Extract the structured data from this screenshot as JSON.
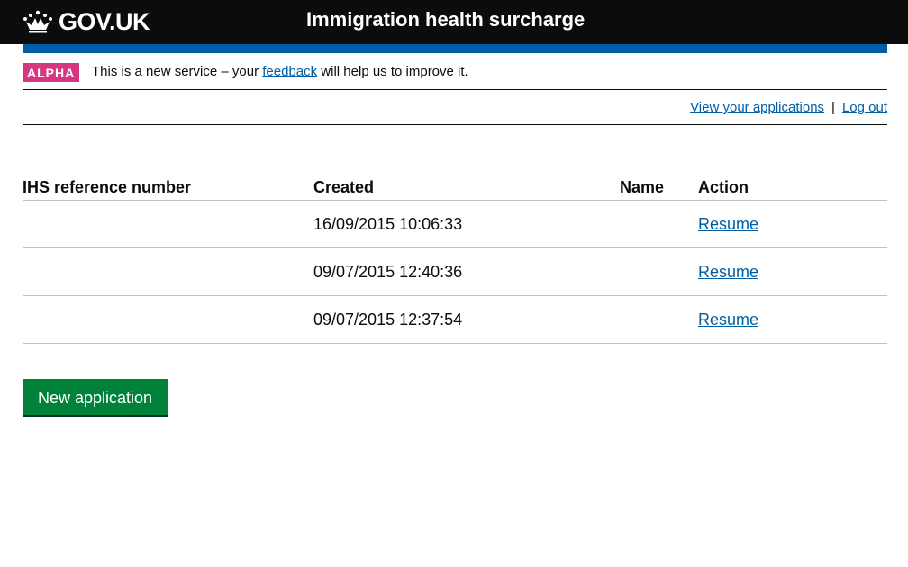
{
  "header": {
    "logo_text": "GOV.UK",
    "logo_icon": "crown-icon",
    "service_name": "Immigration health surcharge"
  },
  "phase_banner": {
    "tag": "ALPHA",
    "text_before": "This is a new service – your ",
    "link_text": "feedback",
    "text_after": " will help us to improve it."
  },
  "account_nav": {
    "view_applications": "View your applications",
    "separator": "|",
    "logout": "Log out"
  },
  "table": {
    "headers": {
      "ref": "IHS reference number",
      "created": "Created",
      "name": "Name",
      "action": "Action"
    },
    "rows": [
      {
        "ref": "",
        "created": "16/09/2015 10:06:33",
        "name": "",
        "action": "Resume"
      },
      {
        "ref": "",
        "created": "09/07/2015 12:40:36",
        "name": "",
        "action": "Resume"
      },
      {
        "ref": "",
        "created": "09/07/2015 12:37:54",
        "name": "",
        "action": "Resume"
      }
    ]
  },
  "new_application_button": "New application",
  "colors": {
    "header_bg": "#0b0c0c",
    "brand_blue": "#005ea5",
    "alpha_tag": "#d53880",
    "button_green": "#00823b"
  }
}
